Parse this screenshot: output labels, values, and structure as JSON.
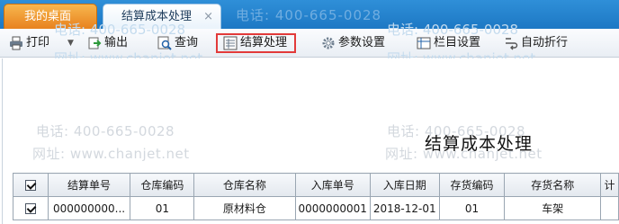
{
  "tabs": {
    "home_label": "我的桌面",
    "active_label": "结算成本处理",
    "close_symbol": "×"
  },
  "watermark": {
    "phone": "电话: 400-665-0028",
    "site": "网址: www.chanjet.net"
  },
  "toolbar": {
    "print_label": "打印",
    "print_caret": "▼",
    "export_label": "输出",
    "query_label": "查询",
    "settle_label": "结算处理",
    "params_label": "参数设置",
    "columns_label": "栏目设置",
    "wrap_label": "自动折行"
  },
  "report": {
    "title": "结算成本处理"
  },
  "grid": {
    "columns": [
      "结算单号",
      "仓库编码",
      "仓库名称",
      "入库单号",
      "入库日期",
      "存货编码",
      "存货名称",
      "计"
    ],
    "rows": [
      [
        "000000000...",
        "01",
        "原材料仓",
        "0000000001",
        "2018-12-01",
        "01",
        "车架",
        ""
      ]
    ]
  },
  "colors": {
    "tab_bar": "#1d78c4",
    "home_tab": "#e8821e",
    "highlight_border": "#e23a3a"
  }
}
